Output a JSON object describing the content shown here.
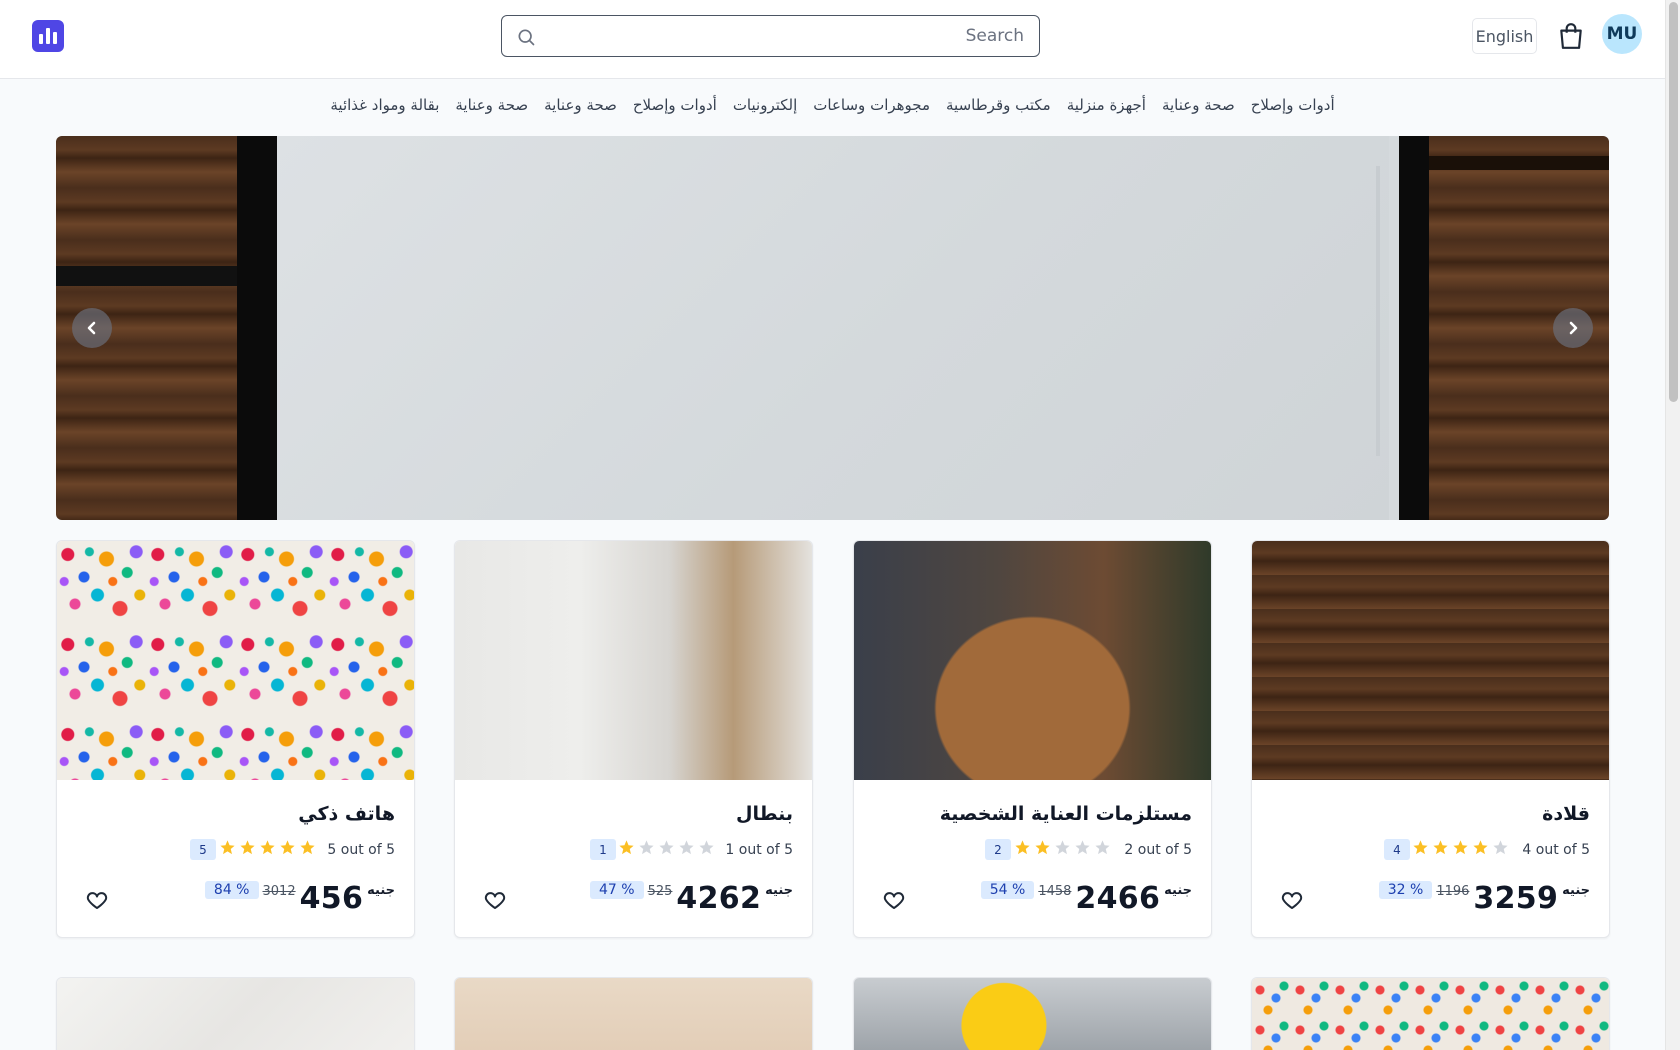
{
  "header": {
    "search_placeholder": "Search",
    "language_label": "English",
    "avatar_initials": "MU",
    "logo_icon": "bar-chart-logo",
    "cart_icon": "shopping-bag-icon"
  },
  "categories": [
    "بقالة ومواد غذائية",
    "صحة وعناية",
    "صحة وعناية",
    "أدوات وإصلاح",
    "إلكترونيات",
    "مجوهرات وساعات",
    "مكتب وقرطاسية",
    "أجهزة منزلية",
    "صحة وعناية",
    "أدوات وإصلاح"
  ],
  "hero": {
    "prev_icon": "chevron-left-icon",
    "next_icon": "chevron-right-icon"
  },
  "products": [
    {
      "title": "قلادة",
      "rating_text": "4 out of 5",
      "rating": 4,
      "review_count": "4",
      "currency": "جنيه",
      "price": "3259",
      "old_price": "1196",
      "discount": "32 %"
    },
    {
      "title": "مستلزمات العناية الشخصية",
      "rating_text": "2 out of 5",
      "rating": 2,
      "review_count": "2",
      "currency": "جنيه",
      "price": "2466",
      "old_price": "1458",
      "discount": "54 %"
    },
    {
      "title": "بنطال",
      "rating_text": "1 out of 5",
      "rating": 1,
      "review_count": "1",
      "currency": "جنيه",
      "price": "4262",
      "old_price": "525",
      "discount": "47 %"
    },
    {
      "title": "هاتف ذكي",
      "rating_text": "5 out of 5",
      "rating": 5,
      "review_count": "5",
      "currency": "جنيه",
      "price": "456",
      "old_price": "3012",
      "discount": "84 %"
    }
  ],
  "colors": {
    "accent": "#4f46e5",
    "star_filled": "#fbbf24",
    "star_empty": "#d1d5db",
    "badge_bg": "#dbeafe",
    "avatar_bg": "#bae6fd"
  }
}
